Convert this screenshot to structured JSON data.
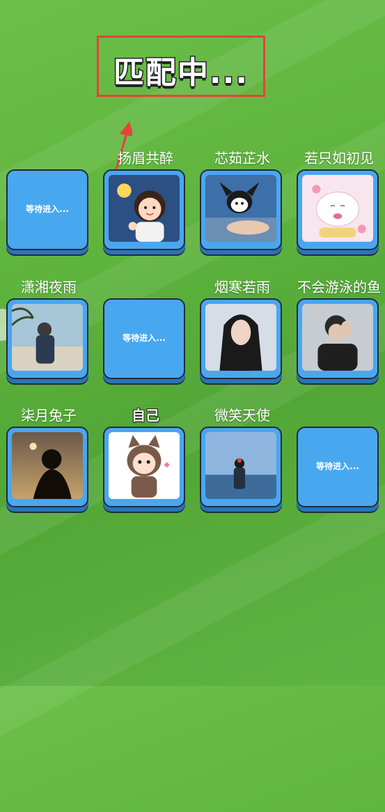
{
  "title": "匹配中...",
  "waiting_label": "等待进入...",
  "players": [
    {
      "name": "",
      "state": "waiting"
    },
    {
      "name": "扬眉共醉",
      "state": "avatar",
      "avatar": "cartoon-girl-icon"
    },
    {
      "name": "芯茹芷水",
      "state": "avatar",
      "avatar": "kuromi-icon"
    },
    {
      "name": "若只如初见",
      "state": "avatar",
      "avatar": "cartoon-bunny-icon"
    },
    {
      "name": "潇湘夜雨",
      "state": "avatar",
      "avatar": "beach-boy-photo"
    },
    {
      "name": "",
      "state": "waiting"
    },
    {
      "name": "烟寒若雨",
      "state": "avatar",
      "avatar": "girl-photo"
    },
    {
      "name": "不会游泳的鱼",
      "state": "avatar",
      "avatar": "thinking-man-photo"
    },
    {
      "name": "柒月兔子",
      "state": "avatar",
      "avatar": "silhouette-photo"
    },
    {
      "name": "自己",
      "state": "avatar",
      "avatar": "cat-hood-girl-icon",
      "self": true
    },
    {
      "name": "微笑天使",
      "state": "avatar",
      "avatar": "sea-girl-photo"
    },
    {
      "name": "",
      "state": "waiting"
    }
  ]
}
